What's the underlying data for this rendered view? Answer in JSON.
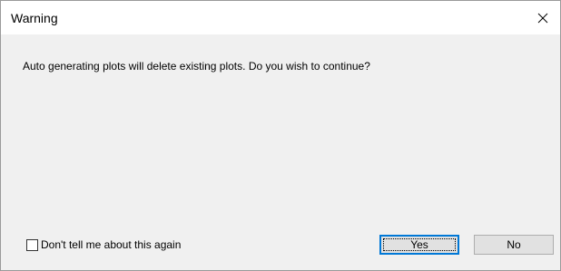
{
  "window": {
    "title": "Warning",
    "close_icon": "close-icon"
  },
  "message": "Auto generating plots will delete existing plots. Do you wish to continue?",
  "checkbox": {
    "label": "Don't tell me about this again",
    "checked": false
  },
  "buttons": {
    "yes_label": "Yes",
    "no_label": "No"
  },
  "colors": {
    "focus_accent": "#0078d7",
    "dialog_background": "#f0f0f0",
    "titlebar_background": "#ffffff"
  }
}
